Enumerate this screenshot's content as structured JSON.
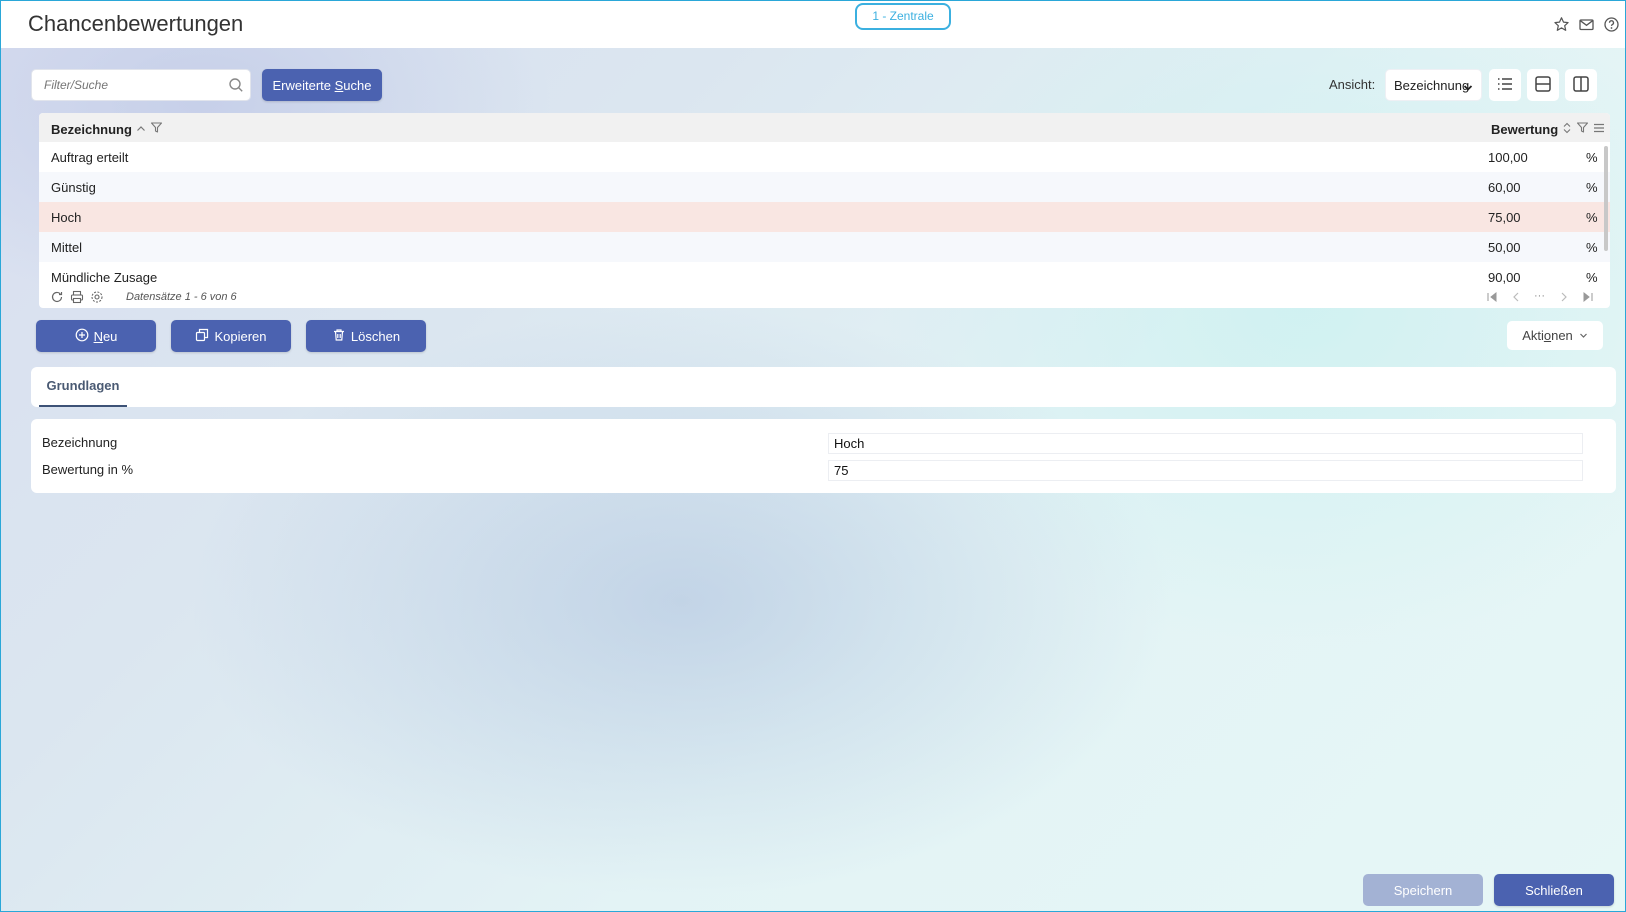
{
  "page": {
    "title": "Chancenbewertungen",
    "branch": "1 - Zentrale"
  },
  "toolbar": {
    "search_placeholder": "Filter/Suche",
    "advanced_search_pre": "Erweiterte ",
    "advanced_search_key": "S",
    "advanced_search_post": "uche",
    "view_label": "Ansicht:",
    "view_value": "Bezeichnung"
  },
  "grid": {
    "columns": {
      "name": "Bezeichnung",
      "rating": "Bewertung"
    },
    "rows": [
      {
        "name": "Auftrag erteilt",
        "rating": "100,00",
        "unit": "%"
      },
      {
        "name": "Günstig",
        "rating": "60,00",
        "unit": "%"
      },
      {
        "name": "Hoch",
        "rating": "75,00",
        "unit": "%"
      },
      {
        "name": "Mittel",
        "rating": "50,00",
        "unit": "%"
      },
      {
        "name": "Mündliche Zusage",
        "rating": "90,00",
        "unit": "%"
      }
    ],
    "record_count": "Datensätze 1 - 6 von 6",
    "pager_dots": "···"
  },
  "actions": {
    "new_key": "N",
    "new_rest": "eu",
    "copy": "Kopieren",
    "delete": "Löschen",
    "more_pre": "Akti",
    "more_key": "o",
    "more_post": "nen"
  },
  "tabs": [
    {
      "label": "Grundlagen"
    }
  ],
  "form": {
    "name_label": "Bezeichnung",
    "name_value": "Hoch",
    "rating_label": "Bewertung in %",
    "rating_value": "75"
  },
  "footer": {
    "save": "Speichern",
    "close": "Schließen"
  },
  "colors": {
    "primary": "#4b62b0",
    "accent": "#3bb0e0",
    "selected_row": "#f9e6e2",
    "disabled": "#a3b2d4"
  }
}
